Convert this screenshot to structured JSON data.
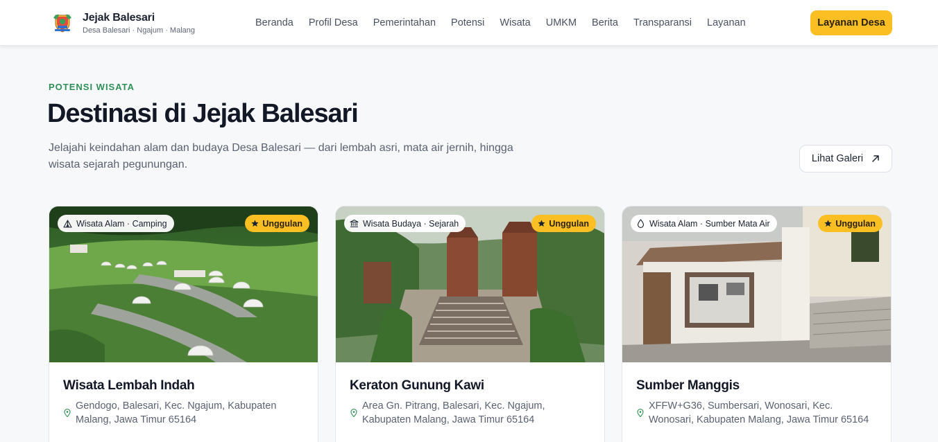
{
  "header": {
    "logo_icon": "village-crest-logo",
    "brand_name": "Jejak Balesari",
    "brand_sub": "Desa Balesari · Ngajum · Malang",
    "nav": [
      "Beranda",
      "Profil Desa",
      "Pemerintahan",
      "Potensi",
      "Wisata",
      "UMKM",
      "Berita",
      "Transparansi",
      "Layanan"
    ],
    "cta_label": "Layanan Desa",
    "accent": "#fbbf24"
  },
  "section": {
    "eyebrow": "POTENSI WISATA",
    "title": "Destinasi di Jejak Balesari",
    "description": "Jelajahi keindahan alam dan budaya Desa Balesari — dari lembah asri, mata air jernih, hingga wisata sejarah pegunungan.",
    "gallery_button": "Lihat Galeri",
    "gallery_icon": "arrow-up-right-icon",
    "eyebrow_color": "#2f8f56"
  },
  "cards": [
    {
      "category": "Wisata Alam · Camping",
      "category_icon": "tent-icon",
      "badge": "Unggulan",
      "badge_icon": "star-icon",
      "title": "Wisata Lembah Indah",
      "address": "Gendogo, Balesari, Kec. Ngajum, Kabupaten Malang, Jawa Timur 65164",
      "address_icon": "map-pin-icon"
    },
    {
      "category": "Wisata Budaya · Sejarah",
      "category_icon": "landmark-icon",
      "badge": "Unggulan",
      "badge_icon": "star-icon",
      "title": "Keraton Gunung Kawi",
      "address": "Area Gn. Pitrang, Balesari, Kec. Ngajum, Kabupaten Malang, Jawa Timur 65164",
      "address_icon": "map-pin-icon"
    },
    {
      "category": "Wisata Alam · Sumber Mata Air",
      "category_icon": "droplet-icon",
      "badge": "Unggulan",
      "badge_icon": "star-icon",
      "title": "Sumber Manggis",
      "address": "XFFW+G36, Sumbersari, Wonosari, Kec. Wonosari, Kabupaten Malang, Jawa Timur 65164",
      "address_icon": "map-pin-icon"
    }
  ]
}
